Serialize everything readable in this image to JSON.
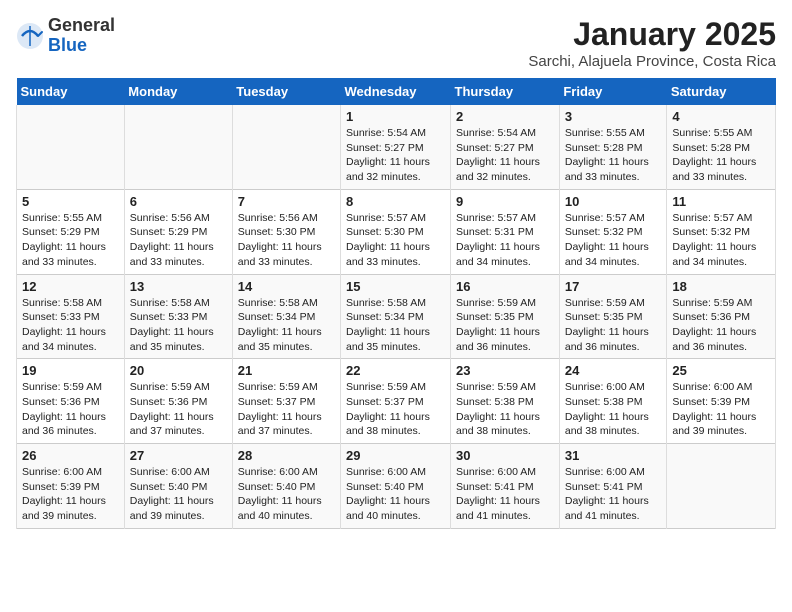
{
  "logo": {
    "general": "General",
    "blue": "Blue"
  },
  "title": "January 2025",
  "subtitle": "Sarchi, Alajuela Province, Costa Rica",
  "days_of_week": [
    "Sunday",
    "Monday",
    "Tuesday",
    "Wednesday",
    "Thursday",
    "Friday",
    "Saturday"
  ],
  "weeks": [
    [
      {
        "day": "",
        "content": ""
      },
      {
        "day": "",
        "content": ""
      },
      {
        "day": "",
        "content": ""
      },
      {
        "day": "1",
        "content": "Sunrise: 5:54 AM\nSunset: 5:27 PM\nDaylight: 11 hours and 32 minutes."
      },
      {
        "day": "2",
        "content": "Sunrise: 5:54 AM\nSunset: 5:27 PM\nDaylight: 11 hours and 32 minutes."
      },
      {
        "day": "3",
        "content": "Sunrise: 5:55 AM\nSunset: 5:28 PM\nDaylight: 11 hours and 33 minutes."
      },
      {
        "day": "4",
        "content": "Sunrise: 5:55 AM\nSunset: 5:28 PM\nDaylight: 11 hours and 33 minutes."
      }
    ],
    [
      {
        "day": "5",
        "content": "Sunrise: 5:55 AM\nSunset: 5:29 PM\nDaylight: 11 hours and 33 minutes."
      },
      {
        "day": "6",
        "content": "Sunrise: 5:56 AM\nSunset: 5:29 PM\nDaylight: 11 hours and 33 minutes."
      },
      {
        "day": "7",
        "content": "Sunrise: 5:56 AM\nSunset: 5:30 PM\nDaylight: 11 hours and 33 minutes."
      },
      {
        "day": "8",
        "content": "Sunrise: 5:57 AM\nSunset: 5:30 PM\nDaylight: 11 hours and 33 minutes."
      },
      {
        "day": "9",
        "content": "Sunrise: 5:57 AM\nSunset: 5:31 PM\nDaylight: 11 hours and 34 minutes."
      },
      {
        "day": "10",
        "content": "Sunrise: 5:57 AM\nSunset: 5:32 PM\nDaylight: 11 hours and 34 minutes."
      },
      {
        "day": "11",
        "content": "Sunrise: 5:57 AM\nSunset: 5:32 PM\nDaylight: 11 hours and 34 minutes."
      }
    ],
    [
      {
        "day": "12",
        "content": "Sunrise: 5:58 AM\nSunset: 5:33 PM\nDaylight: 11 hours and 34 minutes."
      },
      {
        "day": "13",
        "content": "Sunrise: 5:58 AM\nSunset: 5:33 PM\nDaylight: 11 hours and 35 minutes."
      },
      {
        "day": "14",
        "content": "Sunrise: 5:58 AM\nSunset: 5:34 PM\nDaylight: 11 hours and 35 minutes."
      },
      {
        "day": "15",
        "content": "Sunrise: 5:58 AM\nSunset: 5:34 PM\nDaylight: 11 hours and 35 minutes."
      },
      {
        "day": "16",
        "content": "Sunrise: 5:59 AM\nSunset: 5:35 PM\nDaylight: 11 hours and 36 minutes."
      },
      {
        "day": "17",
        "content": "Sunrise: 5:59 AM\nSunset: 5:35 PM\nDaylight: 11 hours and 36 minutes."
      },
      {
        "day": "18",
        "content": "Sunrise: 5:59 AM\nSunset: 5:36 PM\nDaylight: 11 hours and 36 minutes."
      }
    ],
    [
      {
        "day": "19",
        "content": "Sunrise: 5:59 AM\nSunset: 5:36 PM\nDaylight: 11 hours and 36 minutes."
      },
      {
        "day": "20",
        "content": "Sunrise: 5:59 AM\nSunset: 5:36 PM\nDaylight: 11 hours and 37 minutes."
      },
      {
        "day": "21",
        "content": "Sunrise: 5:59 AM\nSunset: 5:37 PM\nDaylight: 11 hours and 37 minutes."
      },
      {
        "day": "22",
        "content": "Sunrise: 5:59 AM\nSunset: 5:37 PM\nDaylight: 11 hours and 38 minutes."
      },
      {
        "day": "23",
        "content": "Sunrise: 5:59 AM\nSunset: 5:38 PM\nDaylight: 11 hours and 38 minutes."
      },
      {
        "day": "24",
        "content": "Sunrise: 6:00 AM\nSunset: 5:38 PM\nDaylight: 11 hours and 38 minutes."
      },
      {
        "day": "25",
        "content": "Sunrise: 6:00 AM\nSunset: 5:39 PM\nDaylight: 11 hours and 39 minutes."
      }
    ],
    [
      {
        "day": "26",
        "content": "Sunrise: 6:00 AM\nSunset: 5:39 PM\nDaylight: 11 hours and 39 minutes."
      },
      {
        "day": "27",
        "content": "Sunrise: 6:00 AM\nSunset: 5:40 PM\nDaylight: 11 hours and 39 minutes."
      },
      {
        "day": "28",
        "content": "Sunrise: 6:00 AM\nSunset: 5:40 PM\nDaylight: 11 hours and 40 minutes."
      },
      {
        "day": "29",
        "content": "Sunrise: 6:00 AM\nSunset: 5:40 PM\nDaylight: 11 hours and 40 minutes."
      },
      {
        "day": "30",
        "content": "Sunrise: 6:00 AM\nSunset: 5:41 PM\nDaylight: 11 hours and 41 minutes."
      },
      {
        "day": "31",
        "content": "Sunrise: 6:00 AM\nSunset: 5:41 PM\nDaylight: 11 hours and 41 minutes."
      },
      {
        "day": "",
        "content": ""
      }
    ]
  ]
}
